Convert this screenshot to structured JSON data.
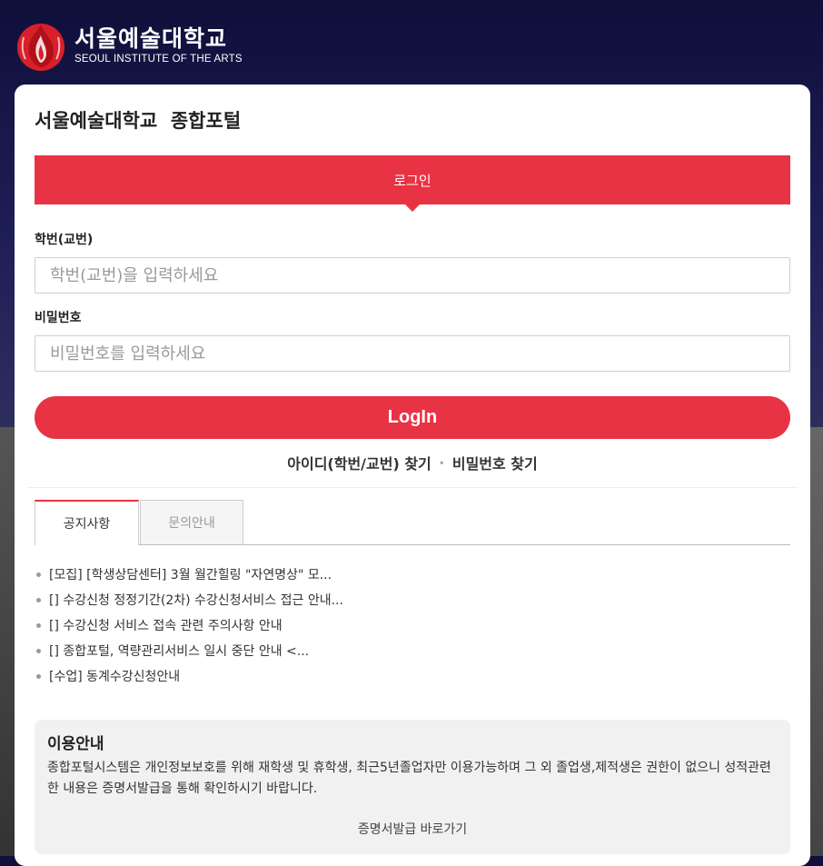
{
  "colors": {
    "accent": "#e83344",
    "info_bg": "#f1f1f1"
  },
  "header": {
    "logo_icon": "flame-logo-icon",
    "logo_kr": "서울예술대학교",
    "logo_en": "SEOUL INSTITUTE OF THE ARTS"
  },
  "portal_title": "서울예술대학교  종합포털",
  "login_tab": "로그인",
  "form": {
    "id_label": "학번(교번)",
    "id_placeholder": "학번(교번)을 입력하세요",
    "pw_label": "비밀번호",
    "pw_placeholder": "비밀번호를 입력하세요",
    "login_button": "LogIn"
  },
  "find": {
    "find_id": "아이디(학번/교번) 찾기",
    "separator": "•",
    "find_pw": "비밀번호 찾기"
  },
  "tabs": [
    {
      "label": "공지사항",
      "active": true
    },
    {
      "label": "문의안내",
      "active": false
    }
  ],
  "notices": [
    "[모집] [학생상담센터] 3월 월간힐링 \"자연명상\" 모...",
    "[] 수강신청 정정기간(2차) 수강신청서비스 접근 안내...",
    "[] 수강신청 서비스 접속 관련 주의사항 안내",
    "[] 종합포털, 역량관리서비스 일시 중단 안내 <...",
    "[수업] 동계수강신청안내"
  ],
  "info": {
    "title": "이용안내",
    "body": "종합포털시스템은 개인정보보호를 위해 재학생 및 휴학생, 최근5년졸업자만 이용가능하며 그 외 졸업생,제적생은 권한이 없으니 성적관련한 내용은 증명서발급을 통해 확인하시기 바랍니다.",
    "link": "증명서발급 바로가기"
  }
}
